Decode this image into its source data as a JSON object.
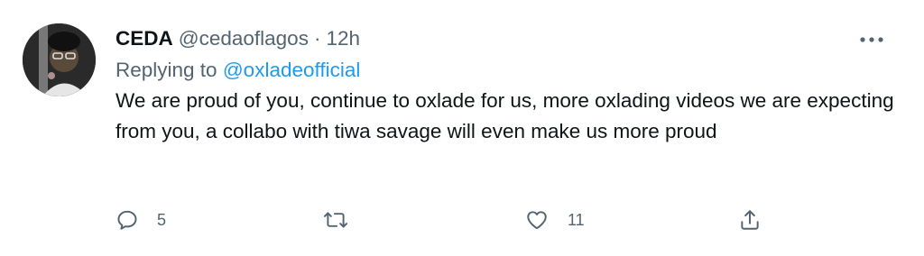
{
  "tweet": {
    "author_name": "CEDA",
    "author_handle": "@cedaoflagos",
    "separator": "·",
    "time": "12h",
    "replying_prefix": "Replying to",
    "replying_to": "@oxladeofficial",
    "text": "We are proud of you, continue to oxlade for us, more oxlading videos we are expecting from you, a collabo with tiwa savage will even make us more proud"
  },
  "actions": {
    "reply": {
      "icon": "reply-icon",
      "count": "5"
    },
    "retweet": {
      "icon": "retweet-icon",
      "count": ""
    },
    "like": {
      "icon": "heart-icon",
      "count": "11"
    },
    "share": {
      "icon": "share-icon",
      "count": ""
    }
  },
  "menu": {
    "icon": "more-options-icon"
  },
  "colors": {
    "text_primary": "#0f1419",
    "text_secondary": "#536471",
    "link": "#1d9bf0",
    "icon": "#536471"
  }
}
